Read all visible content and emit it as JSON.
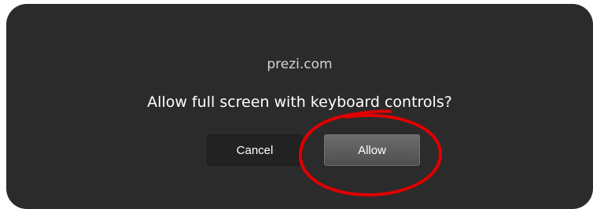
{
  "dialog": {
    "origin": "prezi.com",
    "question": "Allow full screen with keyboard controls?",
    "cancel_label": "Cancel",
    "allow_label": "Allow"
  },
  "colors": {
    "dialog_background": "#2b2b2b",
    "annotation": "#e00000"
  }
}
